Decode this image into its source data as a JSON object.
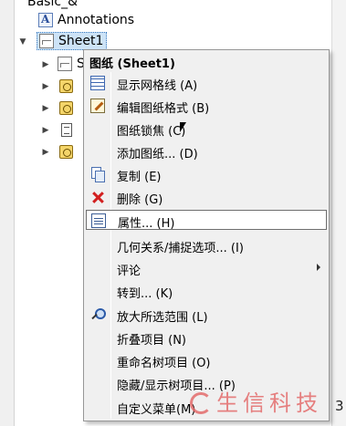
{
  "tree": {
    "top_item_label": "Basic_&",
    "annotations_label": "Annotations",
    "sheet_label": "Sheet1",
    "child_partial_label": "S",
    "child_views_partial": "",
    "right_fragment": "3"
  },
  "context_menu": {
    "title": "图纸 (Sheet1)",
    "items": [
      {
        "label": "显示网格线 (A)",
        "icon": "grid-icon"
      },
      {
        "label": "编辑图纸格式 (B)",
        "icon": "edit-format-icon"
      },
      {
        "label": "图纸锁焦 (C)",
        "icon": ""
      },
      {
        "label": "添加图纸... (D)",
        "icon": ""
      },
      {
        "label": "复制 (E)",
        "icon": "copy-icon"
      },
      {
        "label": "删除 (G)",
        "icon": "delete-icon"
      },
      {
        "label": "属性... (H)",
        "icon": "properties-icon",
        "hovered": true
      },
      {
        "label": "几何关系/捕捉选项... (I)",
        "icon": ""
      },
      {
        "label": "评论",
        "icon": "",
        "submenu": true
      },
      {
        "label": "转到... (K)",
        "icon": ""
      },
      {
        "label": "放大所选范围 (L)",
        "icon": "zoom-icon"
      },
      {
        "label": "折叠项目 (N)",
        "icon": ""
      },
      {
        "label": "重命名树项目 (O)",
        "icon": ""
      },
      {
        "label": "隐藏/显示树项目... (P)",
        "icon": ""
      },
      {
        "label": "自定义菜单(M)",
        "icon": ""
      }
    ]
  },
  "watermark": {
    "text": "生信科技"
  },
  "colors": {
    "menu_bg": "#f0f0f0",
    "hover_bg": "#ffffff",
    "selected_node_bg": "#cde3f7",
    "delete_red": "#d21f1f",
    "watermark_red": "#e46c6c"
  }
}
